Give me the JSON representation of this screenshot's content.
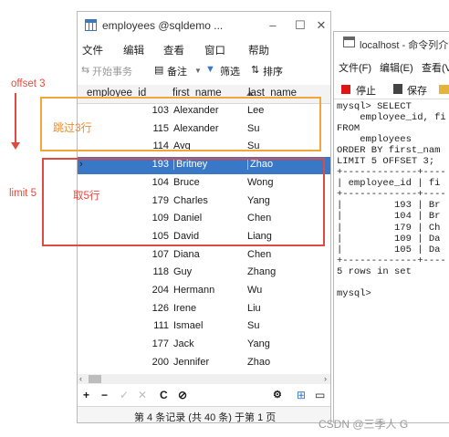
{
  "left_window": {
    "title": "employees @sqldemo ...",
    "window_buttons": {
      "minimize": "–",
      "maximize": "☐",
      "close": "✕"
    },
    "menu": [
      "文件",
      "编辑",
      "查看",
      "窗口",
      "帮助"
    ],
    "toolbar": {
      "begin_tx": "开始事务",
      "notes": "备注",
      "filter": "筛选",
      "sort": "排序"
    },
    "columns": [
      "employee_id",
      "first_name",
      "last_name"
    ],
    "rows": [
      {
        "id": "103",
        "first": "Alexander",
        "last": "Lee"
      },
      {
        "id": "115",
        "first": "Alexander",
        "last": "Su"
      },
      {
        "id": "114",
        "first": "Avg",
        "last": "Su"
      },
      {
        "id": "193",
        "first": "Britney",
        "last": "Zhao"
      },
      {
        "id": "104",
        "first": "Bruce",
        "last": "Wong"
      },
      {
        "id": "179",
        "first": "Charles",
        "last": "Yang"
      },
      {
        "id": "109",
        "first": "Daniel",
        "last": "Chen"
      },
      {
        "id": "105",
        "first": "David",
        "last": "Liang"
      },
      {
        "id": "107",
        "first": "Diana",
        "last": "Chen"
      },
      {
        "id": "118",
        "first": "Guy",
        "last": "Zhang"
      },
      {
        "id": "204",
        "first": "Hermann",
        "last": "Wu"
      },
      {
        "id": "126",
        "first": "Irene",
        "last": "Liu"
      },
      {
        "id": "111",
        "first": "Ismael",
        "last": "Su"
      },
      {
        "id": "177",
        "first": "Jack",
        "last": "Yang"
      },
      {
        "id": "200",
        "first": "Jennifer",
        "last": "Zhao"
      }
    ],
    "selected_row_index": 3,
    "bottom_buttons": {
      "add": "+",
      "remove": "−",
      "apply": "✓",
      "discard": "✕",
      "refresh": "C",
      "stop": "⊘"
    },
    "status": "第 4 条记录 (共 40 条) 于第 1 页"
  },
  "right_window": {
    "title": "localhost - 命令列介",
    "menu": [
      "文件(F)",
      "编辑(E)",
      "查看(V"
    ],
    "toolbar": {
      "stop": "停止",
      "save": "保存"
    },
    "console": "mysql> SELECT\n    employee_id, fi\nFROM\n    employees\nORDER BY first_nam\nLIMIT 5 OFFSET 3;\n+-------------+----\n| employee_id | fi\n+-------------+----\n|         193 | Br\n|         104 | Br\n|         179 | Ch\n|         109 | Da\n|         105 | Da\n+-------------+----\n5 rows in set\n\nmysql>"
  },
  "annotations": {
    "offset_label": "offset 3",
    "skip_label": "跳过3行",
    "limit_label": "limit 5",
    "take_label": "取5行",
    "colors": {
      "orange": "#f3a53c",
      "red": "#e04a3f",
      "selection": "#3977c7"
    }
  },
  "watermark": "CSDN @三季人 G"
}
